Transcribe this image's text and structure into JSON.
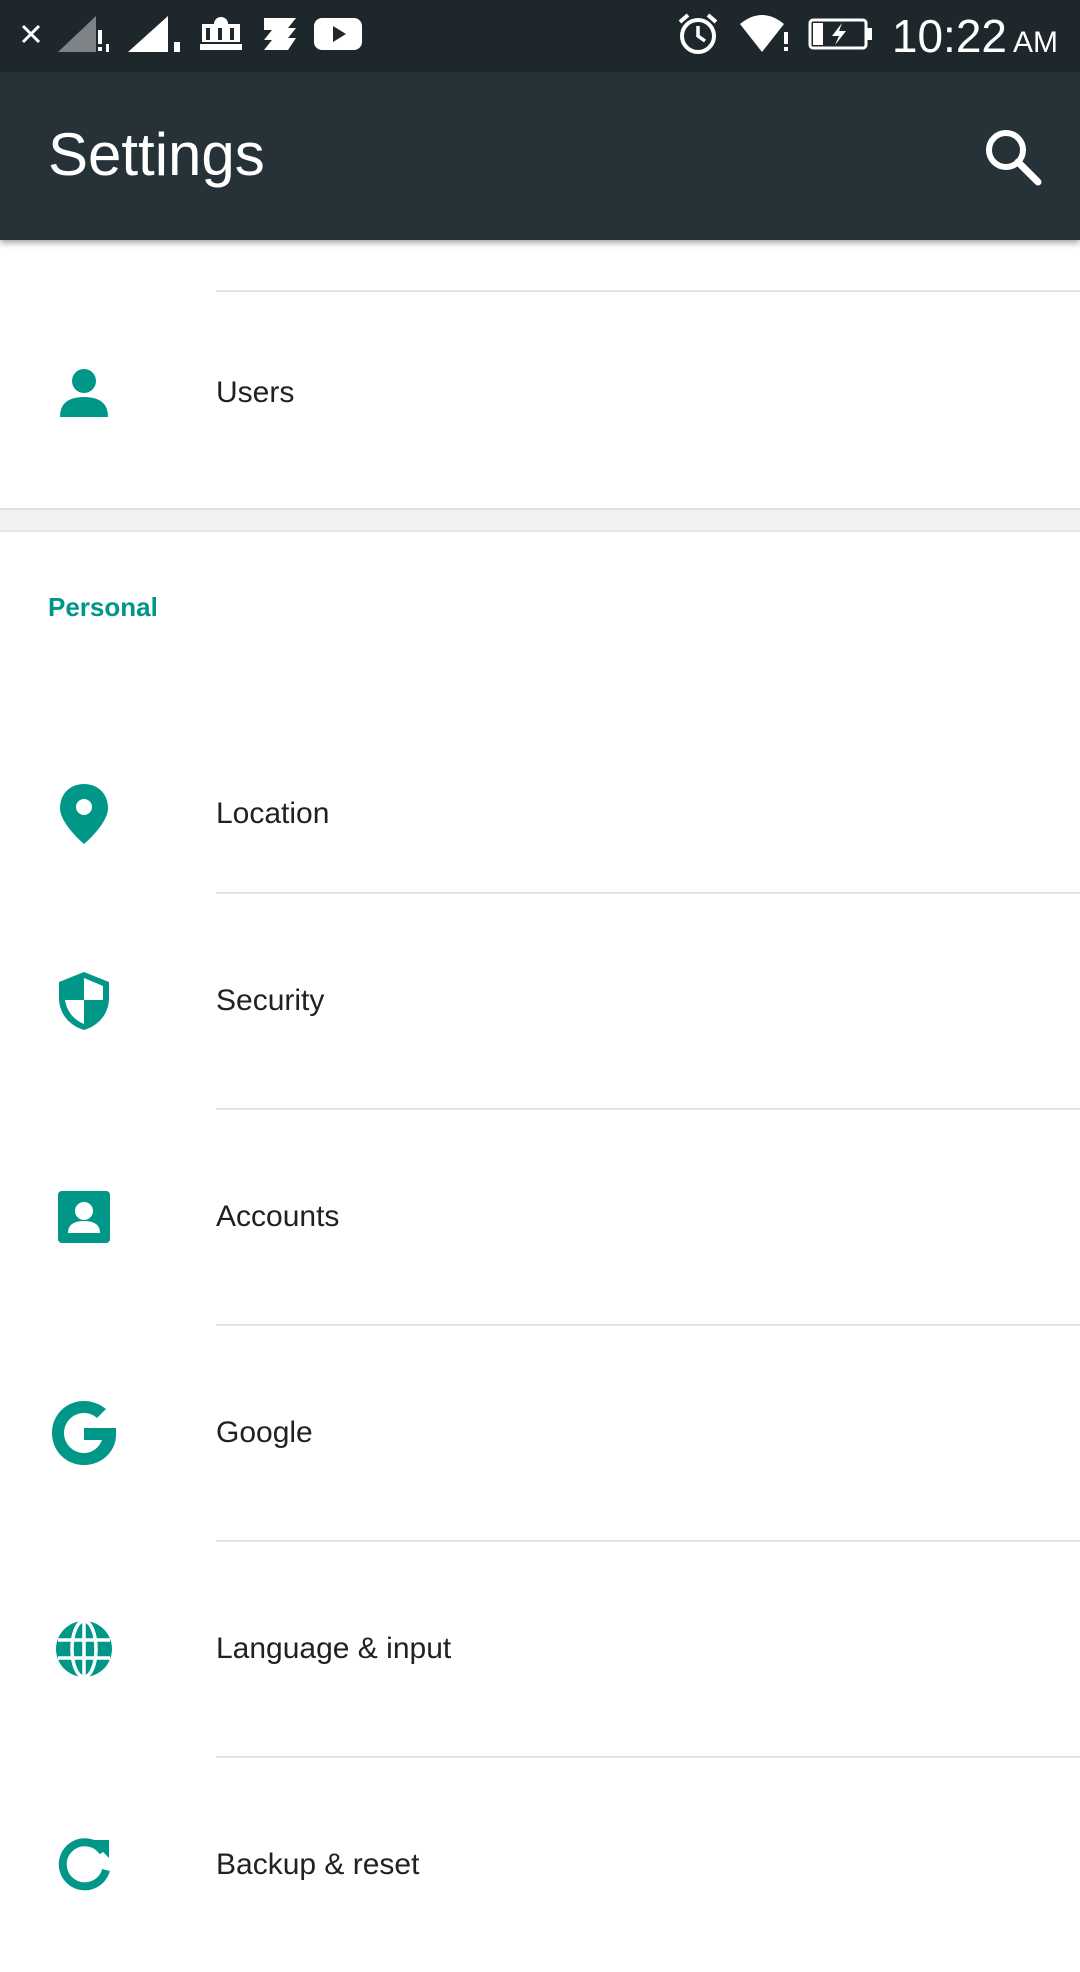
{
  "status_bar": {
    "time": "10:22",
    "ampm": "AM",
    "icons": [
      "close-icon",
      "signal-1-icon",
      "signal-2-icon",
      "emblem-icon",
      "app-icon",
      "youtube-icon",
      "alarm-icon",
      "wifi-icon",
      "battery-charging-icon"
    ]
  },
  "app_bar": {
    "title": "Settings"
  },
  "items_top": [
    {
      "label": "Users",
      "icon": "person-icon"
    }
  ],
  "section": {
    "header": "Personal"
  },
  "items": [
    {
      "label": "Location",
      "icon": "location-icon"
    },
    {
      "label": "Security",
      "icon": "shield-icon"
    },
    {
      "label": "Accounts",
      "icon": "account-box-icon"
    },
    {
      "label": "Google",
      "icon": "google-icon"
    },
    {
      "label": "Language & input",
      "icon": "globe-icon"
    },
    {
      "label": "Backup & reset",
      "icon": "refresh-icon"
    }
  ],
  "colors": {
    "accent": "#009688",
    "app_bar": "#263238",
    "status_bar": "#1e272c"
  }
}
